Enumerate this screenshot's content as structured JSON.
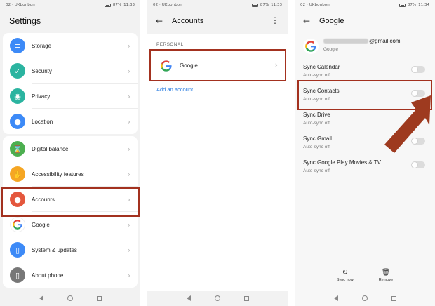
{
  "status": {
    "carrier": "02 · UKbonbon",
    "battery": "87%",
    "time_p1": "11:33",
    "time_p2": "11:33",
    "time_p3": "11:34"
  },
  "settings": {
    "title": "Settings",
    "items": [
      {
        "label": "Storage",
        "icon": "storage-icon",
        "color": "#3d8af7",
        "glyph": "≡"
      },
      {
        "label": "Security",
        "icon": "shield-check-icon",
        "color": "#2bb4a0",
        "glyph": "✓"
      },
      {
        "label": "Privacy",
        "icon": "privacy-icon",
        "color": "#2bb4a0",
        "glyph": "◉"
      },
      {
        "label": "Location",
        "icon": "location-pin-icon",
        "color": "#3d8af7",
        "glyph": "●"
      },
      {
        "label": "Digital balance",
        "icon": "hourglass-icon",
        "color": "#4caf50",
        "glyph": "⌛"
      },
      {
        "label": "Accessibility features",
        "icon": "hand-icon",
        "color": "#f5a623",
        "glyph": "✋"
      },
      {
        "label": "Accounts",
        "icon": "person-icon",
        "color": "#e4573d",
        "glyph": "●"
      },
      {
        "label": "Google",
        "icon": "google-icon",
        "color": "#ffffff",
        "glyph": "G"
      },
      {
        "label": "System & updates",
        "icon": "phone-system-icon",
        "color": "#3d8af7",
        "glyph": "▯"
      },
      {
        "label": "About phone",
        "icon": "info-icon",
        "color": "#777777",
        "glyph": "▯"
      }
    ]
  },
  "accounts": {
    "title": "Accounts",
    "section": "PERSONAL",
    "google_label": "Google",
    "add_label": "Add an account"
  },
  "google": {
    "title": "Google",
    "email_suffix": "@gmail.com",
    "provider": "Google",
    "syncs": [
      {
        "name": "Sync Calendar",
        "sub": "Auto-sync off"
      },
      {
        "name": "Sync Contacts",
        "sub": "Auto-sync off"
      },
      {
        "name": "Sync Drive",
        "sub": "Auto-sync off"
      },
      {
        "name": "Sync Gmail",
        "sub": "Auto-sync off"
      },
      {
        "name": "Sync Google Play Movies & TV",
        "sub": "Auto-sync off"
      }
    ],
    "sync_now": "Sync now",
    "remove": "Remove"
  },
  "colors": {
    "highlight": "#a3311f",
    "link": "#2a7de1"
  }
}
